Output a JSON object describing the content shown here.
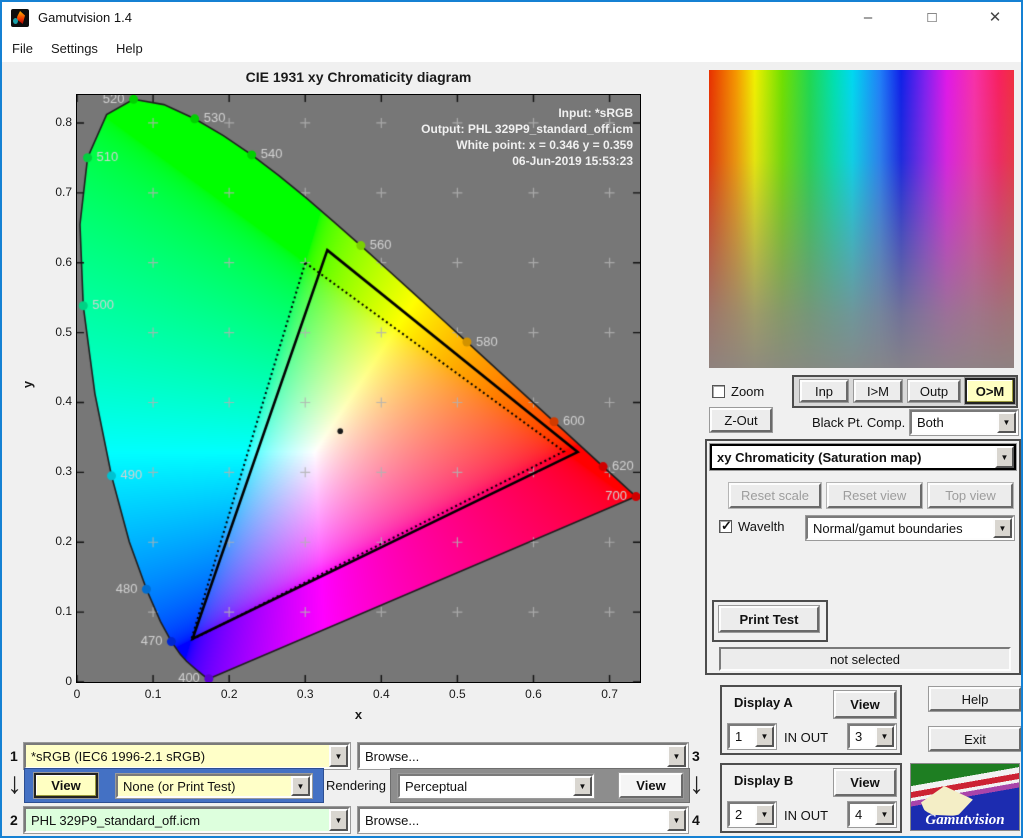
{
  "window": {
    "title": "Gamutvision 1.4",
    "menu": [
      "File",
      "Settings",
      "Help"
    ],
    "controls": {
      "minimize": "–",
      "maximize": "□",
      "close": "✕"
    }
  },
  "icons": {
    "dropdown_arrow": "▼",
    "checkmark": "✓",
    "down_arrow": "↓"
  },
  "colors": {
    "accent_yellow": "#ffffc8",
    "accent_green": "#ddffdd",
    "blue_panel": "#4471c4",
    "gray_panel": "#8d8d8d",
    "window_border": "#1581d3",
    "plot_bg": "#777777"
  },
  "chart_data": {
    "type": "scatter",
    "title": "CIE 1931 xy Chromaticity diagram",
    "xlabel": "x",
    "ylabel": "y",
    "xlim": [
      0,
      0.74
    ],
    "ylim": [
      0,
      0.84
    ],
    "x_ticks": [
      "0",
      "0.1",
      "0.2",
      "0.3",
      "0.4",
      "0.5",
      "0.6",
      "0.7"
    ],
    "y_ticks": [
      "0",
      "0.1",
      "0.2",
      "0.3",
      "0.4",
      "0.5",
      "0.6",
      "0.7",
      "0.8"
    ],
    "grid": true,
    "annotations": [
      "Input:  *sRGB",
      "Output: PHL 329P9_standard_off.icm",
      "White point:  x = 0.346  y = 0.359",
      "06-Jun-2019 15:53:23"
    ],
    "white_point": {
      "x": 0.346,
      "y": 0.359
    },
    "gamuts": [
      {
        "name": "output-gamut",
        "style": "solid",
        "points": [
          [
            0.329,
            0.618
          ],
          [
            0.658,
            0.329
          ],
          [
            0.152,
            0.062
          ]
        ]
      },
      {
        "name": "input-gamut-sRGB",
        "style": "dotted",
        "points": [
          [
            0.3,
            0.6
          ],
          [
            0.64,
            0.33
          ],
          [
            0.15,
            0.06
          ]
        ]
      }
    ],
    "wavelength_marks": [
      {
        "nm": "400",
        "x": 0.1733,
        "y": 0.0048,
        "side": "left"
      },
      {
        "nm": "470",
        "x": 0.1241,
        "y": 0.0578,
        "side": "left"
      },
      {
        "nm": "480",
        "x": 0.0913,
        "y": 0.1327,
        "side": "left"
      },
      {
        "nm": "490",
        "x": 0.0454,
        "y": 0.295,
        "side": "right"
      },
      {
        "nm": "500",
        "x": 0.0082,
        "y": 0.5384,
        "side": "right"
      },
      {
        "nm": "510",
        "x": 0.0139,
        "y": 0.7502,
        "side": "right"
      },
      {
        "nm": "520",
        "x": 0.0743,
        "y": 0.8338,
        "side": "left"
      },
      {
        "nm": "530",
        "x": 0.1547,
        "y": 0.8059,
        "side": "right"
      },
      {
        "nm": "540",
        "x": 0.2296,
        "y": 0.7543,
        "side": "right"
      },
      {
        "nm": "560",
        "x": 0.3731,
        "y": 0.6245,
        "side": "right"
      },
      {
        "nm": "580",
        "x": 0.5125,
        "y": 0.4866,
        "side": "right"
      },
      {
        "nm": "600",
        "x": 0.627,
        "y": 0.3725,
        "side": "right"
      },
      {
        "nm": "620",
        "x": 0.6915,
        "y": 0.3083,
        "side": "right"
      },
      {
        "nm": "700",
        "x": 0.7347,
        "y": 0.2653,
        "side": "left"
      }
    ],
    "spectral_locus": [
      [
        0.1741,
        0.005
      ],
      [
        0.1738,
        0.0049
      ],
      [
        0.1733,
        0.0048
      ],
      [
        0.1726,
        0.0048
      ],
      [
        0.1714,
        0.0051
      ],
      [
        0.1689,
        0.0069
      ],
      [
        0.1644,
        0.0109
      ],
      [
        0.1566,
        0.0177
      ],
      [
        0.144,
        0.0297
      ],
      [
        0.1355,
        0.0399
      ],
      [
        0.1241,
        0.0578
      ],
      [
        0.1096,
        0.0868
      ],
      [
        0.0913,
        0.1327
      ],
      [
        0.0687,
        0.2007
      ],
      [
        0.0454,
        0.295
      ],
      [
        0.0235,
        0.4127
      ],
      [
        0.0082,
        0.5384
      ],
      [
        0.0039,
        0.6548
      ],
      [
        0.0139,
        0.7502
      ],
      [
        0.0389,
        0.812
      ],
      [
        0.0743,
        0.8338
      ],
      [
        0.1142,
        0.8262
      ],
      [
        0.1547,
        0.8059
      ],
      [
        0.1929,
        0.7816
      ],
      [
        0.2296,
        0.7543
      ],
      [
        0.2658,
        0.7243
      ],
      [
        0.3016,
        0.6923
      ],
      [
        0.3373,
        0.6589
      ],
      [
        0.3731,
        0.6245
      ],
      [
        0.4087,
        0.5896
      ],
      [
        0.4441,
        0.5547
      ],
      [
        0.4788,
        0.5202
      ],
      [
        0.5125,
        0.4866
      ],
      [
        0.5448,
        0.4544
      ],
      [
        0.5752,
        0.4242
      ],
      [
        0.6029,
        0.3965
      ],
      [
        0.627,
        0.3725
      ],
      [
        0.6482,
        0.3514
      ],
      [
        0.6658,
        0.334
      ],
      [
        0.6801,
        0.3197
      ],
      [
        0.6915,
        0.3083
      ],
      [
        0.7006,
        0.2993
      ],
      [
        0.7079,
        0.292
      ],
      [
        0.714,
        0.2859
      ],
      [
        0.719,
        0.2809
      ],
      [
        0.726,
        0.274
      ],
      [
        0.7347,
        0.2653
      ]
    ]
  },
  "right_panel": {
    "zoom_label": "Zoom",
    "zoom_checked": false,
    "view_buttons": [
      "Inp",
      "I>M",
      "Outp",
      "O>M"
    ],
    "active_view_button": "O>M",
    "zout_label": "Z-Out",
    "black_pt_label": "Black Pt. Comp.",
    "black_pt_value": "Both",
    "map_select_value": "xy Chromaticity (Saturation map)",
    "reset_buttons": [
      "Reset scale",
      "Reset view",
      "Top view"
    ],
    "wavelth_label": "Wavelth",
    "wavelth_checked": true,
    "boundaries_value": "Normal/gamut boundaries",
    "print_test_label": "Print Test",
    "status": "not selected",
    "display_a": {
      "label": "Display A",
      "view": "View",
      "in_value": "1",
      "inout_label": "IN  OUT",
      "out_value": "3"
    },
    "display_b": {
      "label": "Display B",
      "view": "View",
      "in_value": "2",
      "inout_label": "IN  OUT",
      "out_value": "4"
    },
    "help_label": "Help",
    "exit_label": "Exit",
    "logo_text": "Gamutvision"
  },
  "bottom": {
    "num1": "1",
    "num2": "2",
    "num3": "3",
    "num4": "4",
    "input_profile": "*sRGB   (IEC6 1996-2.1 sRGB)",
    "output_profile": "PHL 329P9_standard_off.icm",
    "browse_top": "Browse...",
    "browse_bottom": "Browse...",
    "view_left": "View",
    "proof_value": "None (or Print Test)",
    "rendering_label": "Rendering",
    "rendering_value": "Perceptual",
    "view_right": "View"
  }
}
